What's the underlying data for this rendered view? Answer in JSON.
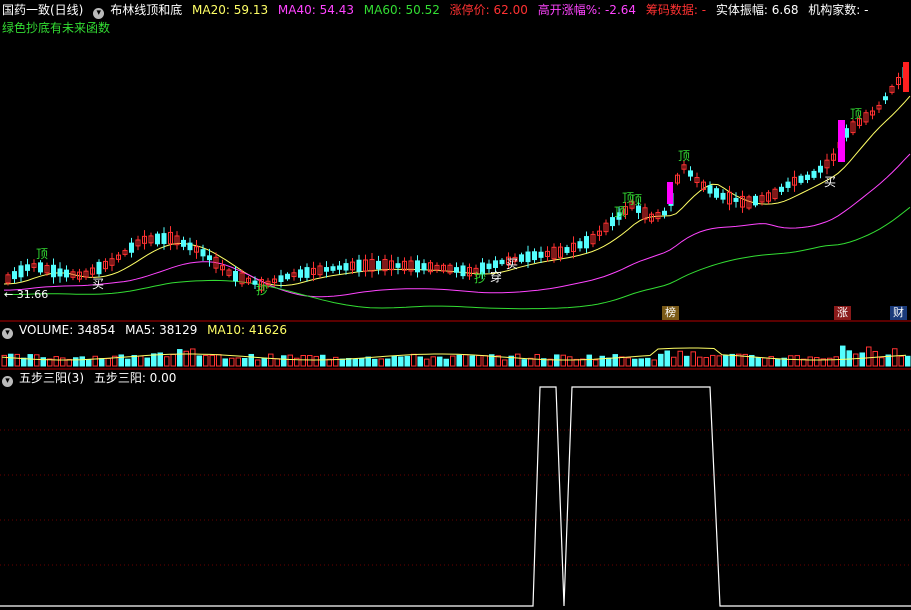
{
  "header": {
    "stock_name": "国药一致(日线)",
    "indicator_name": "布林线顶和底",
    "ma20": "MA20: 59.13",
    "ma40": "MA40: 54.43",
    "ma60": "MA60: 50.52",
    "limit_up": "涨停价: 62.00",
    "open_gap": "高开涨幅%: -2.64",
    "chips": "筹码数据: -",
    "body_amp": "实体振幅: 6.68",
    "inst": "机构家数: -",
    "subtitle": "绿色抄底有未来函数"
  },
  "price_panel": {
    "low_label": "31.66",
    "signals": {
      "top": "顶",
      "bottom": "抄",
      "buy": "买",
      "break": "穿"
    },
    "badges": {
      "list": "榜",
      "rise": "涨",
      "fin": "财"
    }
  },
  "volume_panel": {
    "label": "VOLUME: 34854",
    "ma5": "MA5: 38129",
    "ma10": "MA10: 41626"
  },
  "fivestep_panel": {
    "label": "五步三阳(3)",
    "value": "五步三阳: 0.00"
  },
  "colors": {
    "up": "#ff3232",
    "down": "#54ffff",
    "ma20": "#ffff66",
    "ma40": "#ff44ff",
    "ma60": "#33dd33",
    "magenta_bar": "#ff00ff",
    "divider": "#b40000"
  },
  "chart_data": [
    {
      "type": "candlestick",
      "title": "国药一致(日线)",
      "y_marker": 31.66,
      "lines": [
        "MA20",
        "MA40",
        "MA60"
      ]
    },
    {
      "type": "bar",
      "title": "VOLUME",
      "ma5": 38129,
      "ma10": 41626
    },
    {
      "type": "line",
      "title": "五步三阳(3)",
      "current_value": 0.0
    }
  ]
}
